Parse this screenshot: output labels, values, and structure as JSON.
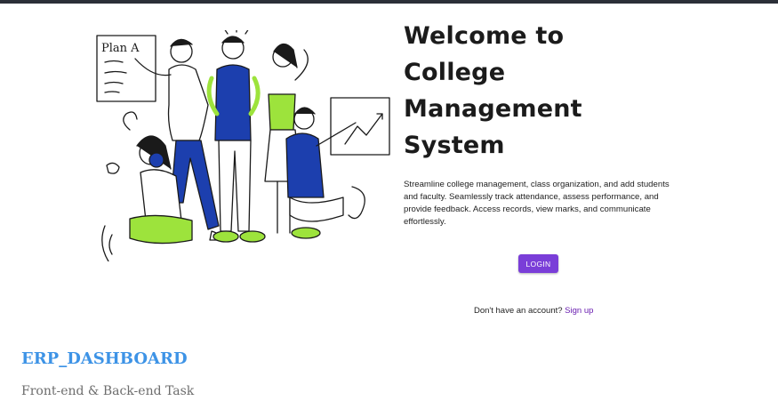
{
  "hero": {
    "title_lines": [
      "Welcome to",
      "College",
      "Management",
      "System"
    ],
    "description": "Streamline college management, class organization, and add students and faculty. Seamlessly track attendance, assess performance, and provide feedback. Access records, view marks, and communicate effortlessly.",
    "illustration_sign": "Plan A"
  },
  "auth": {
    "login_label": "LOGIN",
    "signup_prompt": "Don't have an account?",
    "signup_link": "Sign up"
  },
  "footer": {
    "brand": "ERP_DASHBOARD",
    "tagline": "Front-end & Back-end Task"
  },
  "colors": {
    "accent_purple": "#7a3ed8",
    "brand_blue": "#3d93e6",
    "illustration_blue": "#1c3fae",
    "illustration_green": "#9de33c"
  }
}
